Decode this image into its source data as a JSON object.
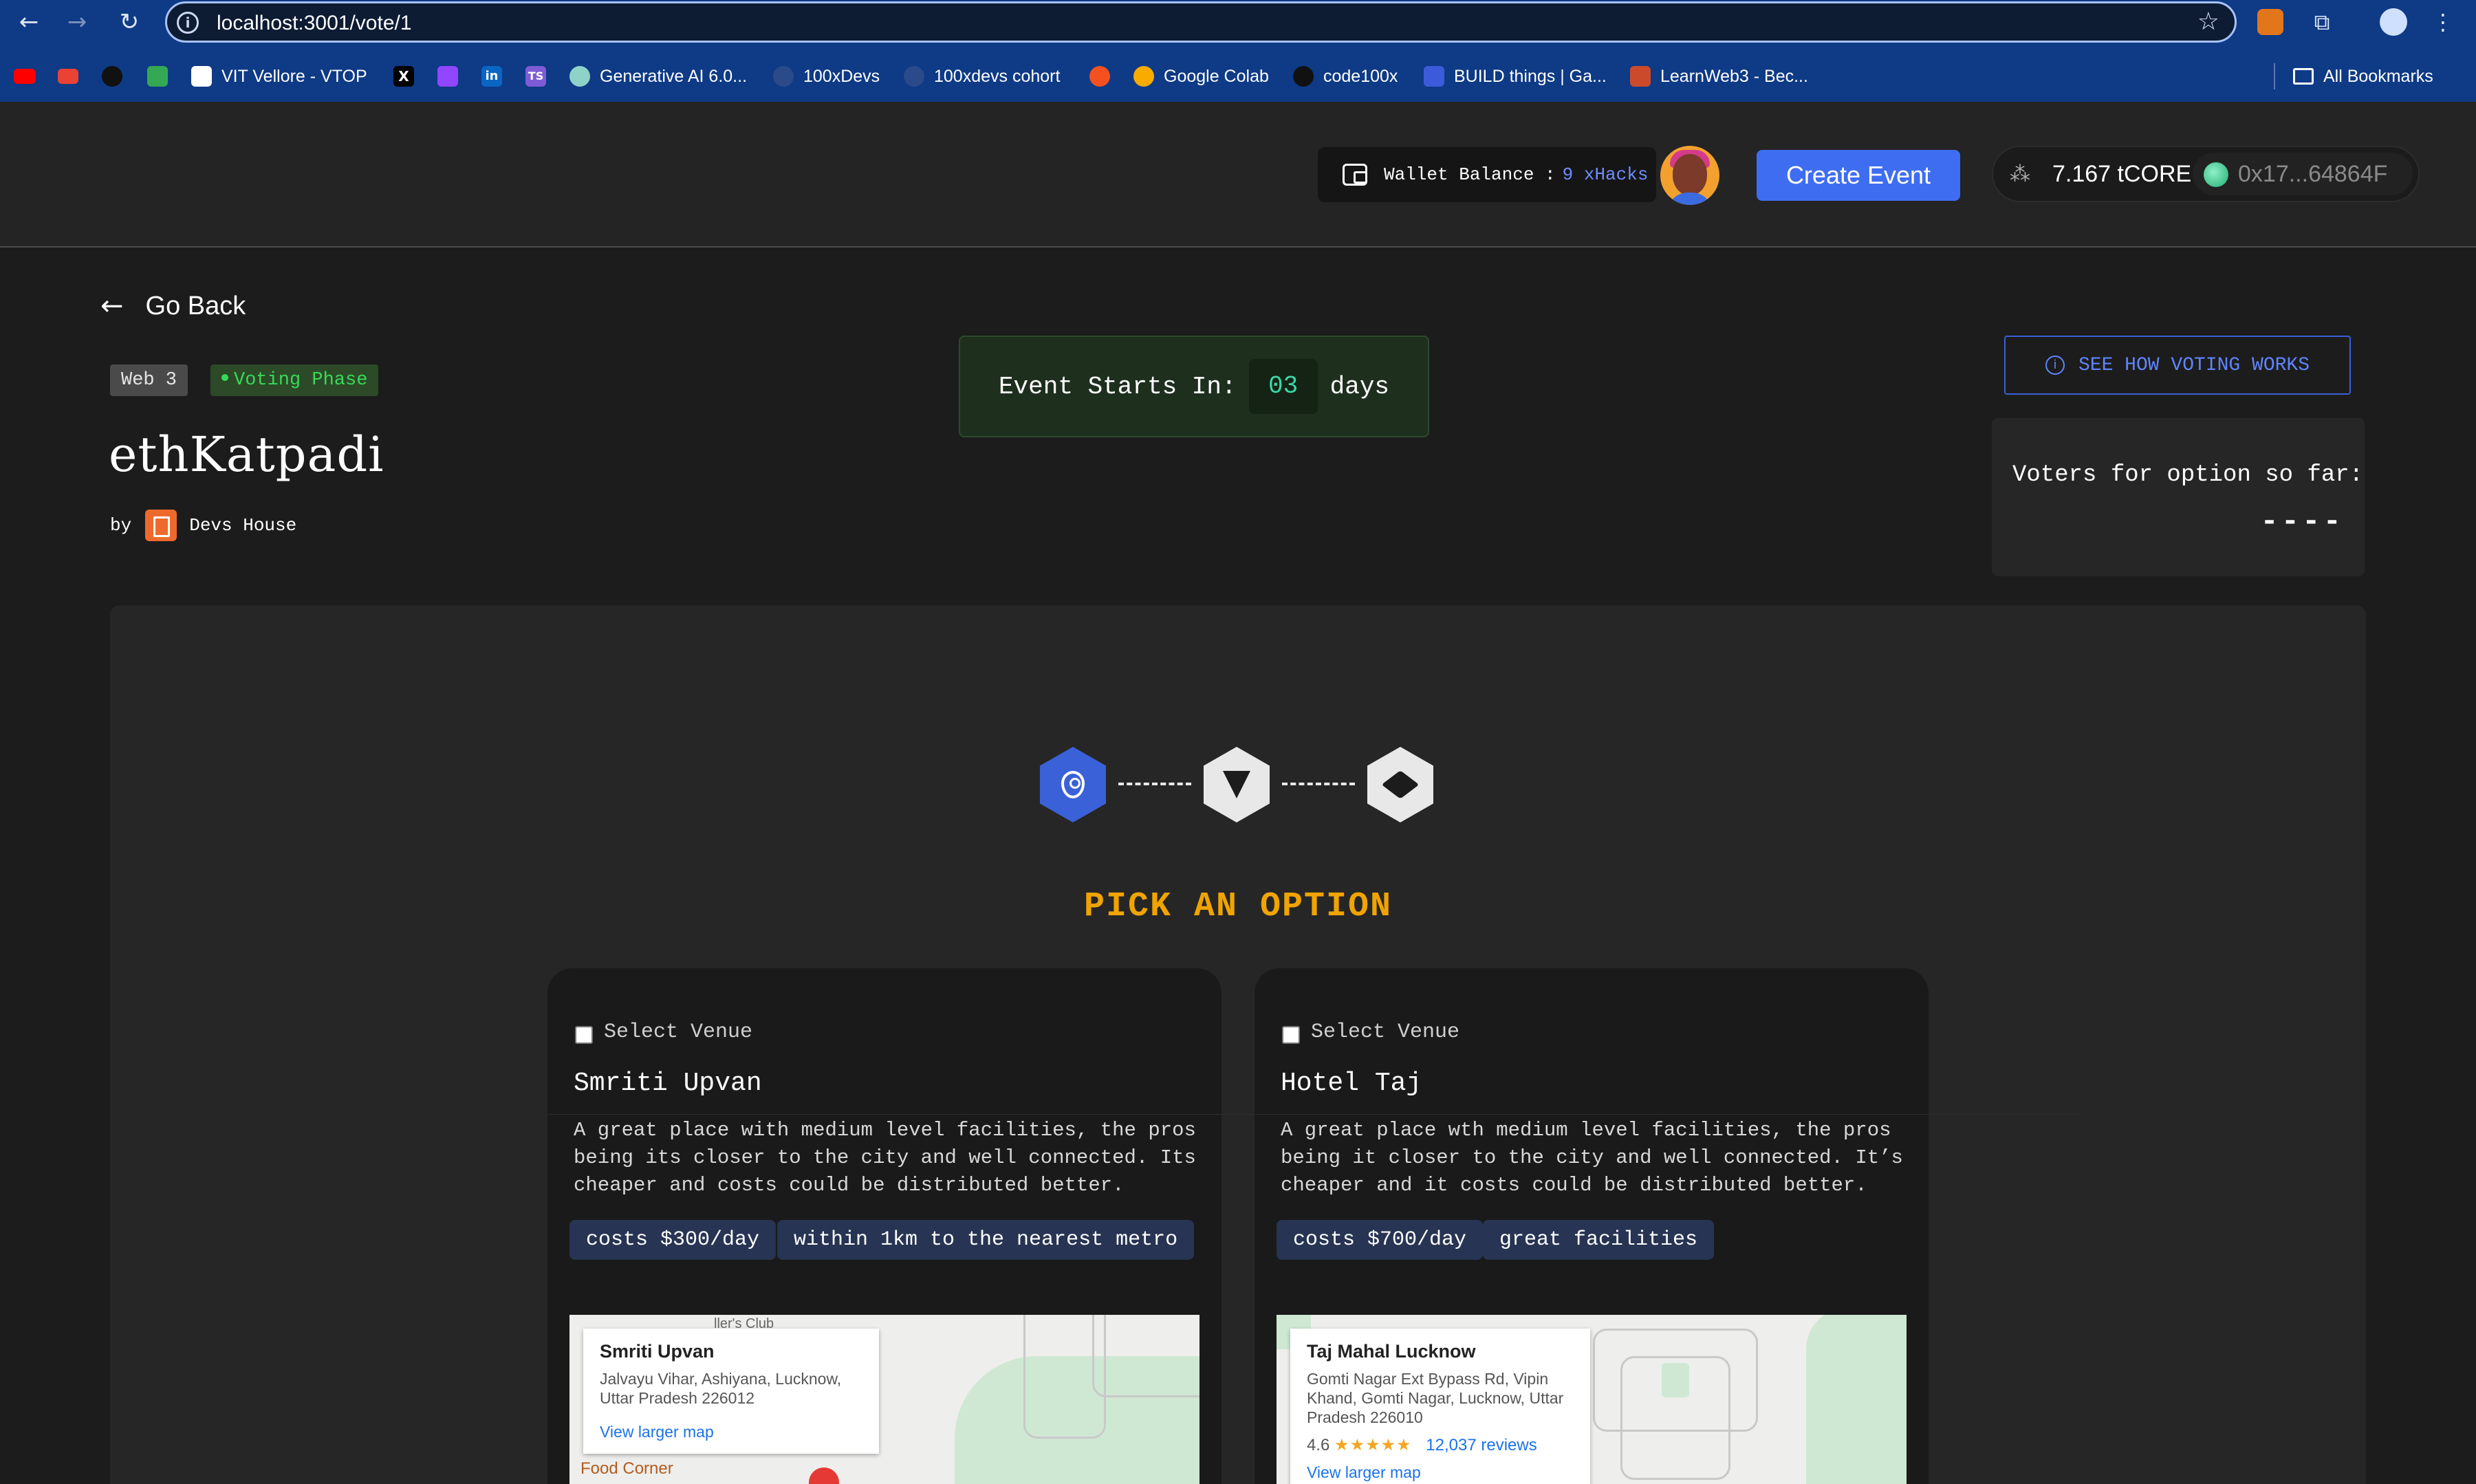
{
  "browser": {
    "url": "localhost:3001/vote/1",
    "bookmarks": [
      {
        "label": "",
        "icon": "youtube-icon",
        "color": "#ff0000"
      },
      {
        "label": "",
        "icon": "gmail-icon",
        "color": "#ea4335"
      },
      {
        "label": "",
        "icon": "github-icon",
        "color": "#222222"
      },
      {
        "label": "",
        "icon": "google-meet-icon",
        "color": "#34a853"
      },
      {
        "label": "VIT Vellore - VTOP",
        "icon": "vtop-icon",
        "color": "#ffffff"
      },
      {
        "label": "",
        "icon": "x-icon",
        "color": "#000000"
      },
      {
        "label": "",
        "icon": "twitch-icon",
        "color": "#9146ff"
      },
      {
        "label": "",
        "icon": "linkedin-icon",
        "color": "#0a66c2"
      },
      {
        "label": "",
        "icon": "typescript-icon",
        "color": "#7d5cd6"
      },
      {
        "label": "Generative AI 6.0...",
        "icon": "genai-icon",
        "color": "#8fd3c8"
      },
      {
        "label": "100xDevs",
        "icon": "100xdevs-icon",
        "color": "#2b4a8a"
      },
      {
        "label": "100xdevs cohort",
        "icon": "cohort-icon",
        "color": "#2b4a8a"
      },
      {
        "label": "",
        "icon": "swirl-icon",
        "color": "#f4511e"
      },
      {
        "label": "Google Colab",
        "icon": "colab-icon",
        "color": "#f9ab00"
      },
      {
        "label": "code100x",
        "icon": "github-icon",
        "color": "#222222"
      },
      {
        "label": "BUILD things | Ga...",
        "icon": "build-icon",
        "color": "#3b5bdb"
      },
      {
        "label": "LearnWeb3 - Bec...",
        "icon": "learnweb3-icon",
        "color": "#cc4a2c"
      }
    ],
    "all_bookmarks": "All Bookmarks"
  },
  "header": {
    "wallet_label": "Wallet Balance :",
    "wallet_amount": "9 xHacks",
    "create_event": "Create Event",
    "token_balance": "7.167 tCORE",
    "address": "0x17...64864F"
  },
  "event": {
    "go_back": "Go Back",
    "tag_category": "Web 3",
    "tag_phase": "Voting Phase",
    "title": "ethKatpadi",
    "by": "by",
    "organizer": "Devs House",
    "countdown_label": "Event Starts In:",
    "countdown_value": "03",
    "countdown_unit": "days",
    "how_voting": "SEE HOW VOTING WORKS",
    "voters_label": "Voters for option so far:",
    "voters_value": "----"
  },
  "picker": {
    "heading": "PICK AN OPTION",
    "steps": [
      "location-pin-icon",
      "pizza-icon",
      "cube-icon"
    ],
    "active_step": 0
  },
  "options": [
    {
      "select_label": "Select Venue",
      "name": "Smriti Upvan",
      "description": "A great place with medium level facilities, the pros being its closer to the city and well connected. Its cheaper and costs could be distributed better.",
      "chips": [
        "costs $300/day",
        "within 1km to the nearest metro"
      ],
      "map": {
        "title": "Smriti Upvan",
        "address": "Jalvayu Vihar, Ashiyana, Lucknow, Uttar Pradesh 226012",
        "link": "View larger map",
        "poi": "Food Corner",
        "street": "ller's Club"
      }
    },
    {
      "select_label": "Select Venue",
      "name": "Hotel Taj",
      "description": "A great place wth medium level facilities, the pros being it closer to the city and well connected. It’s cheaper and it costs could be distributed better.",
      "chips": [
        "costs $700/day",
        "great facilities"
      ],
      "map": {
        "title": "Taj Mahal Lucknow",
        "address": "Gomti Nagar Ext Bypass Rd, Vipin Khand, Gomti Nagar, Lucknow, Uttar Pradesh 226010",
        "rating": "4.6",
        "stars": "★★★★★",
        "reviews": "12,037 reviews",
        "link": "View larger map"
      }
    }
  ]
}
